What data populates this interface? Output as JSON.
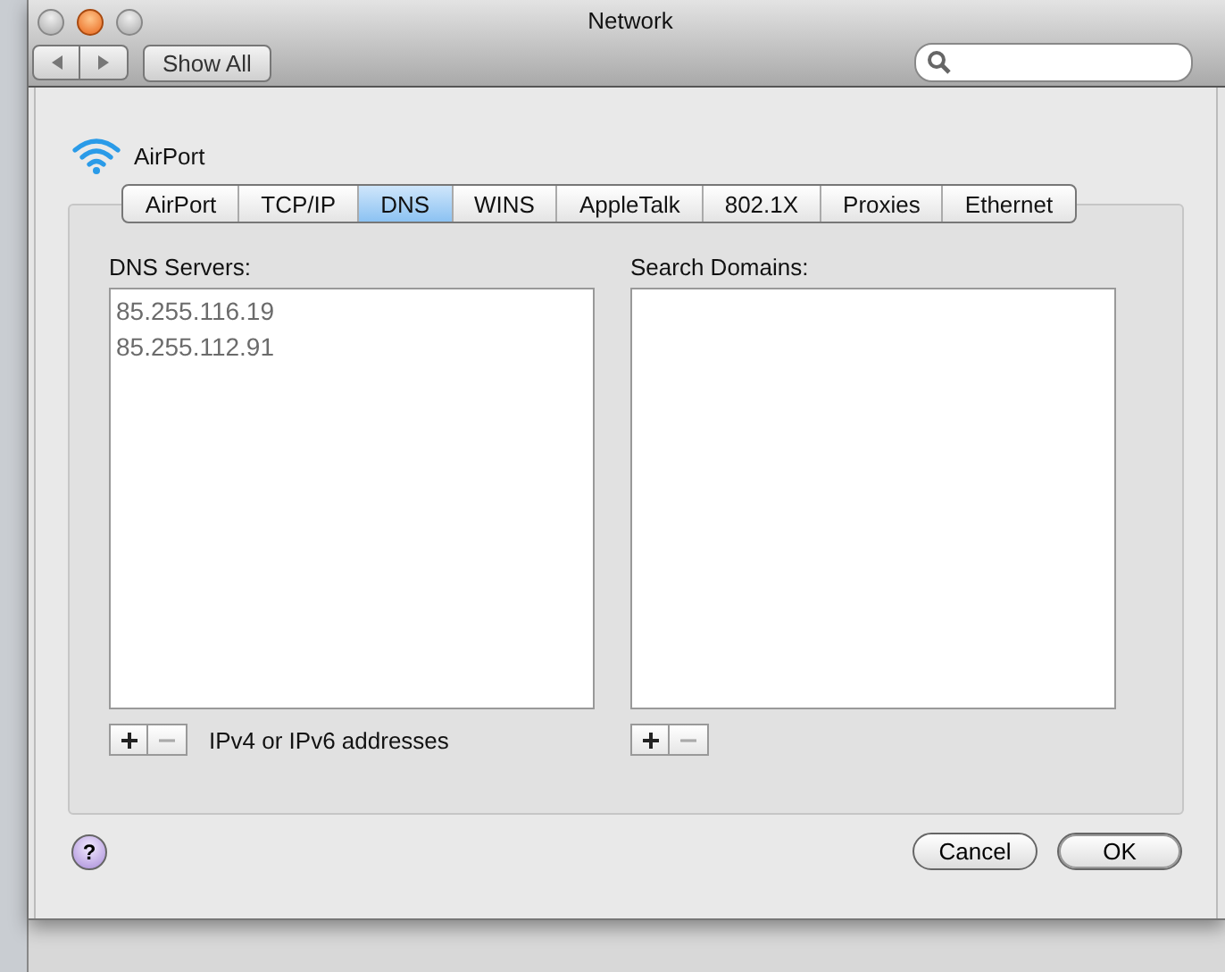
{
  "window": {
    "title": "Network"
  },
  "toolbar": {
    "show_all": "Show All"
  },
  "service": {
    "name": "AirPort"
  },
  "tabs": [
    {
      "label": "AirPort",
      "selected": false
    },
    {
      "label": "TCP/IP",
      "selected": false
    },
    {
      "label": "DNS",
      "selected": true
    },
    {
      "label": "WINS",
      "selected": false
    },
    {
      "label": "AppleTalk",
      "selected": false
    },
    {
      "label": "802.1X",
      "selected": false
    },
    {
      "label": "Proxies",
      "selected": false
    },
    {
      "label": "Ethernet",
      "selected": false
    }
  ],
  "dns_servers": {
    "label": "DNS Servers:",
    "items": [
      "85.255.116.19",
      "85.255.112.91"
    ],
    "hint": "IPv4 or IPv6 addresses"
  },
  "search_domains": {
    "label": "Search Domains:"
  },
  "help": "?",
  "buttons": [
    {
      "label": "Cancel",
      "default": false
    },
    {
      "label": "OK",
      "default": true
    }
  ]
}
